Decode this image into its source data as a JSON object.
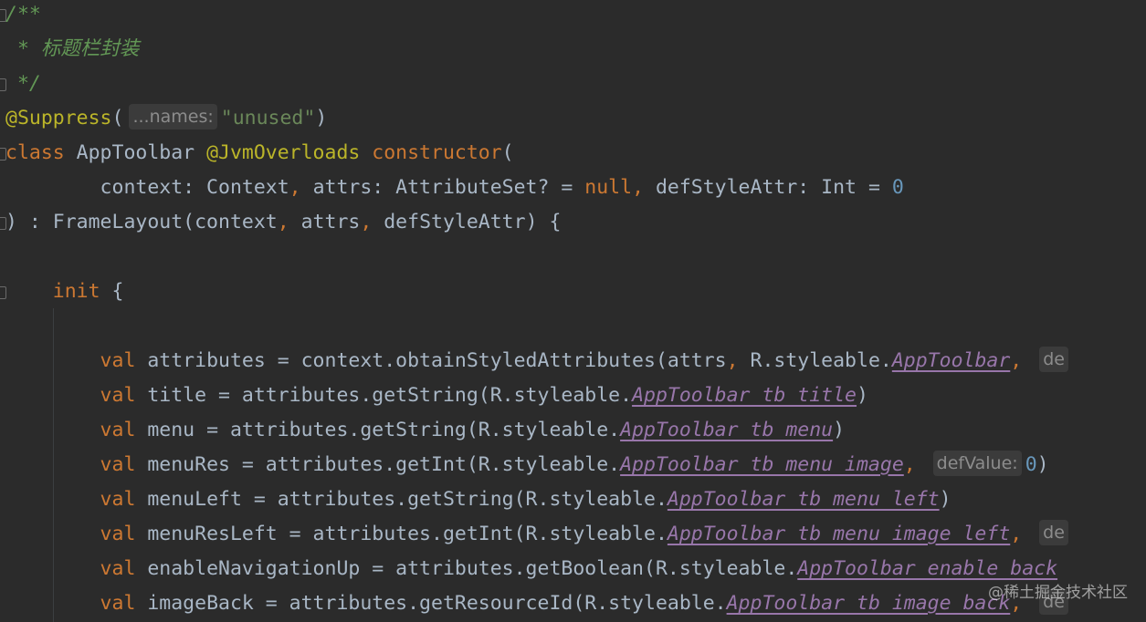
{
  "editor": {
    "lines": [
      [
        {
          "t": "/**",
          "c": "comment"
        }
      ],
      [
        {
          "t": " * 标题栏封装",
          "c": "comment"
        }
      ],
      [
        {
          "t": " */",
          "c": "comment"
        }
      ],
      [
        {
          "t": "@Suppress",
          "c": "ann"
        },
        {
          "t": "(",
          "c": "plain"
        },
        {
          "t": "...names:",
          "c": "hint"
        },
        {
          "t": "\"unused\"",
          "c": "str"
        },
        {
          "t": ")",
          "c": "plain"
        }
      ],
      [
        {
          "t": "class ",
          "c": "kw"
        },
        {
          "t": "AppToolbar ",
          "c": "plain"
        },
        {
          "t": "@JvmOverloads ",
          "c": "ann"
        },
        {
          "t": "constructor",
          "c": "kw"
        },
        {
          "t": "(",
          "c": "plain"
        }
      ],
      [
        {
          "t": "        context: Context",
          "c": "plain"
        },
        {
          "t": ", ",
          "c": "kw"
        },
        {
          "t": "attrs: AttributeSet? = ",
          "c": "plain"
        },
        {
          "t": "null",
          "c": "kw"
        },
        {
          "t": ", ",
          "c": "kw"
        },
        {
          "t": "defStyleAttr: Int = ",
          "c": "plain"
        },
        {
          "t": "0",
          "c": "num"
        }
      ],
      [
        {
          "t": ") : FrameLayout(context",
          "c": "plain"
        },
        {
          "t": ", ",
          "c": "kw"
        },
        {
          "t": "attrs",
          "c": "plain"
        },
        {
          "t": ", ",
          "c": "kw"
        },
        {
          "t": "defStyleAttr) {",
          "c": "plain"
        }
      ],
      [],
      [
        {
          "t": "    init ",
          "c": "kw"
        },
        {
          "t": "{",
          "c": "plain"
        }
      ],
      [],
      [
        {
          "t": "        val ",
          "c": "kw"
        },
        {
          "t": "attributes = context.obtainStyledAttributes(attrs",
          "c": "plain"
        },
        {
          "t": ", ",
          "c": "kw"
        },
        {
          "t": "R.styleable.",
          "c": "plain"
        },
        {
          "t": "AppToolbar",
          "c": "field"
        },
        {
          "t": ", ",
          "c": "kw"
        },
        {
          "t": "de",
          "c": "hint"
        }
      ],
      [
        {
          "t": "        val ",
          "c": "kw"
        },
        {
          "t": "title = attributes.getString(R.styleable.",
          "c": "plain"
        },
        {
          "t": "AppToolbar_tb_title",
          "c": "field"
        },
        {
          "t": ")",
          "c": "plain"
        }
      ],
      [
        {
          "t": "        val ",
          "c": "kw"
        },
        {
          "t": "menu = attributes.getString(R.styleable.",
          "c": "plain"
        },
        {
          "t": "AppToolbar_tb_menu",
          "c": "field"
        },
        {
          "t": ")",
          "c": "plain"
        }
      ],
      [
        {
          "t": "        val ",
          "c": "kw"
        },
        {
          "t": "menuRes = attributes.getInt(R.styleable.",
          "c": "plain"
        },
        {
          "t": "AppToolbar_tb_menu_image",
          "c": "field"
        },
        {
          "t": ", ",
          "c": "kw"
        },
        {
          "t": "defValue:",
          "c": "hint"
        },
        {
          "t": "0",
          "c": "num"
        },
        {
          "t": ")",
          "c": "plain"
        }
      ],
      [
        {
          "t": "        val ",
          "c": "kw"
        },
        {
          "t": "menuLeft = attributes.getString(R.styleable.",
          "c": "plain"
        },
        {
          "t": "AppToolbar_tb_menu_left",
          "c": "field"
        },
        {
          "t": ")",
          "c": "plain"
        }
      ],
      [
        {
          "t": "        val ",
          "c": "kw"
        },
        {
          "t": "menuResLeft = attributes.getInt(R.styleable.",
          "c": "plain"
        },
        {
          "t": "AppToolbar_tb_menu_image_left",
          "c": "field"
        },
        {
          "t": ", ",
          "c": "kw"
        },
        {
          "t": "de",
          "c": "hint"
        }
      ],
      [
        {
          "t": "        val ",
          "c": "kw"
        },
        {
          "t": "enableNavigationUp = attributes.getBoolean(R.styleable.",
          "c": "plain"
        },
        {
          "t": "AppToolbar_enable_back",
          "c": "field"
        }
      ],
      [
        {
          "t": "        val ",
          "c": "kw"
        },
        {
          "t": "imageBack = attributes.getResourceId(R.styleable.",
          "c": "plain"
        },
        {
          "t": "AppToolbar_tb_image_back",
          "c": "field"
        },
        {
          "t": ", ",
          "c": "kw"
        },
        {
          "t": "de",
          "c": "hint"
        }
      ]
    ]
  },
  "watermark": "@稀土掘金技术社区",
  "colors": {
    "background": "#2b2b2b",
    "keyword": "#cc7832",
    "annotation": "#bbb529",
    "string": "#6a8759",
    "number": "#6897bb",
    "comment": "#629755",
    "field": "#9876aa",
    "text": "#a9b7c6"
  }
}
